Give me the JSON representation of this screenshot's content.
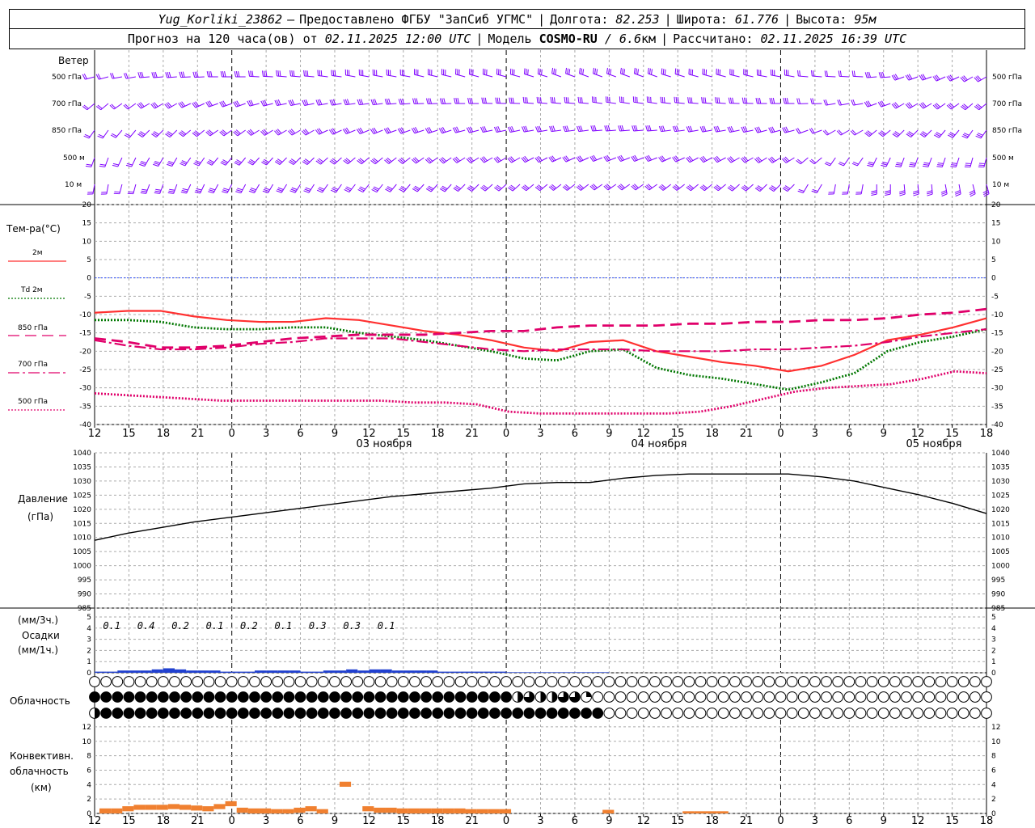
{
  "header": {
    "station": "Yug_Korliki_23862",
    "dash": "–",
    "provider": "Предоставлено ФГБУ \"ЗапСиб УГМС\"",
    "lon_label": "Долгота:",
    "lon_value": "82.253",
    "lat_label": "Широта:",
    "lat_value": "61.776",
    "alt_label": "Высота:",
    "alt_value": "95м",
    "forecast_prefix": "Прогноз на 120 часа(ов) от",
    "forecast_time": "02.11.2025 12:00 UTC",
    "model_label": "Модель",
    "model_name": "COSMO-RU",
    "model_res": "/ 6.6",
    "model_res_unit": "км",
    "calc_label": "Рассчитано:",
    "calc_time": "02.11.2025 16:39 UTC"
  },
  "panels": {
    "wind": {
      "title": "Ветер",
      "levels": [
        "500 гПа",
        "700 гПа",
        "850 гПа",
        "500 м",
        "10 м"
      ],
      "color": "#7f00ff"
    },
    "temperature": {
      "title": "Тем-ра(°С)",
      "legend": [
        {
          "label": "2м",
          "color": "#ff3030",
          "dash": "solid"
        },
        {
          "label": "Td 2м",
          "color": "#007700",
          "dash": "dots"
        },
        {
          "label": "850 гПа",
          "color": "#e0006a",
          "dash": "longdash"
        },
        {
          "label": "700 гПа",
          "color": "#e0006a",
          "dash": "dashdot"
        },
        {
          "label": "500 гПа",
          "color": "#e0006a",
          "dash": "dots"
        }
      ]
    },
    "pressure": {
      "title": "Давление",
      "unit": "(гПа)"
    },
    "precip": {
      "unit3": "(мм/3ч.)",
      "title": "Осадки",
      "unit1": "(мм/1ч.)"
    },
    "cloud": {
      "title": "Облачность"
    },
    "convective": {
      "line1": "Конвективн.",
      "line2": "облачность",
      "unit": "(км)"
    }
  },
  "x_axis": {
    "hour_labels": [
      "12",
      "15",
      "18",
      "21",
      "0",
      "3",
      "6",
      "9",
      "12",
      "15",
      "18",
      "21",
      "0",
      "3",
      "6",
      "9",
      "12",
      "15",
      "18",
      "21",
      "0",
      "3",
      "6",
      "9",
      "12",
      "15",
      "18"
    ],
    "dates": [
      "03 ноября",
      "04 ноября",
      "05 ноября"
    ]
  },
  "chart_data": [
    {
      "type": "line",
      "title": "Тем-ра(°С)",
      "ylim": [
        -40,
        20
      ],
      "y_ticks": [
        "20",
        "15",
        "10",
        "5",
        "0",
        "-5",
        "-10",
        "-15",
        "-20",
        "-25",
        "-30",
        "-35",
        "-40"
      ],
      "x_hours_from_start": [
        0,
        3,
        6,
        9,
        12,
        15,
        18,
        21,
        24,
        27,
        30,
        33,
        36,
        39,
        42,
        45,
        48,
        51,
        54,
        57,
        60,
        63,
        66,
        69,
        72,
        75,
        78
      ],
      "series": [
        {
          "name": "2м",
          "values": [
            -9.5,
            -9,
            -9,
            -10.5,
            -11.5,
            -12,
            -12,
            -11,
            -11.5,
            -13,
            -14.5,
            -15.5,
            -17,
            -19,
            -20,
            -17.5,
            -17,
            -20,
            -21.5,
            -23,
            -24,
            -25.5,
            -24,
            -21,
            -17,
            -15.5,
            -13.5,
            -11
          ]
        },
        {
          "name": "Td 2м",
          "values": [
            -11.5,
            -11.5,
            -12,
            -13.5,
            -14,
            -14,
            -13.5,
            -13.5,
            -15,
            -16,
            -17,
            -18.5,
            -20,
            -22,
            -22.5,
            -20,
            -19.5,
            -24.5,
            -26.5,
            -27.5,
            -29,
            -30.5,
            -28.5,
            -26,
            -20,
            -17.5,
            -16,
            -14
          ]
        },
        {
          "name": "850 гПа",
          "values": [
            -16.5,
            -17.5,
            -19,
            -19,
            -18.5,
            -17.5,
            -16.5,
            -16,
            -15.5,
            -15.5,
            -15.5,
            -15,
            -14.5,
            -14.5,
            -13.5,
            -13,
            -13,
            -13,
            -12.5,
            -12.5,
            -12,
            -12,
            -11.5,
            -11.5,
            -11,
            -10,
            -9.5,
            -8.5
          ]
        },
        {
          "name": "700 гПа",
          "values": [
            -17,
            -18.5,
            -19.5,
            -19.5,
            -19,
            -18,
            -17.5,
            -16.5,
            -16.5,
            -16.5,
            -17.5,
            -18.5,
            -19.5,
            -20,
            -19.5,
            -19.5,
            -19.5,
            -20,
            -20,
            -20,
            -19.5,
            -19.5,
            -19,
            -18.5,
            -17.5,
            -16,
            -15,
            -14
          ]
        },
        {
          "name": "500 гПа",
          "values": [
            -31.5,
            -32,
            -32.5,
            -33,
            -33.5,
            -33.5,
            -33.5,
            -33.5,
            -33.5,
            -33.5,
            -34,
            -34,
            -34.5,
            -36.5,
            -37,
            -37,
            -37,
            -37,
            -37,
            -36.5,
            -35,
            -33,
            -31,
            -30,
            -29.5,
            -29,
            -27.5,
            -25.5,
            -26
          ]
        }
      ]
    },
    {
      "type": "line",
      "title": "Давление",
      "ylabel": "(гПа)",
      "ylim": [
        985,
        1040
      ],
      "y_ticks": [
        "1040",
        "1035",
        "1030",
        "1025",
        "1020",
        "1015",
        "1010",
        "1005",
        "1000",
        "995",
        "990",
        "985"
      ],
      "x_hours_from_start": [
        0,
        3,
        6,
        9,
        12,
        15,
        18,
        21,
        24,
        27,
        30,
        33,
        36,
        39,
        42,
        45,
        48,
        51,
        54,
        57,
        60,
        63,
        66,
        69,
        72,
        75,
        78
      ],
      "series": [
        {
          "name": "Давление",
          "values": [
            1009,
            1011.5,
            1013.5,
            1015.5,
            1017,
            1018.5,
            1020,
            1021.5,
            1023,
            1024.5,
            1025.5,
            1026.5,
            1027.5,
            1029,
            1029.5,
            1029.5,
            1031,
            1032,
            1032.5,
            1032.5,
            1032.5,
            1032.5,
            1031.5,
            1030,
            1027.5,
            1025,
            1022,
            1018.5
          ]
        }
      ]
    },
    {
      "type": "bar",
      "title": "Осадки",
      "ylabel": "(мм/3ч.) / (мм/1ч.)",
      "ylim": [
        0,
        5
      ],
      "y_ticks": [
        "5",
        "4",
        "3",
        "2",
        "1",
        "0"
      ],
      "labels_3h": [
        "0.1",
        "0.4",
        "0.2",
        "0.1",
        "0.2",
        "0.1",
        "0.3",
        "0.3",
        "0.1"
      ],
      "hourly_values": [
        0.1,
        0.1,
        0.2,
        0.2,
        0.2,
        0.3,
        0.4,
        0.3,
        0.2,
        0.2,
        0.2,
        0.1,
        0.1,
        0.1,
        0.2,
        0.2,
        0.2,
        0.2,
        0.1,
        0.1,
        0.2,
        0.2,
        0.3,
        0.2,
        0.3,
        0.3,
        0.2,
        0.2,
        0.2,
        0.2,
        0.1,
        0.1,
        0.1,
        0.1,
        0.1,
        0.1,
        0.05,
        0.05,
        0.05,
        0.05,
        0.05,
        0.05,
        0.05,
        0.05,
        0.05,
        0
      ]
    },
    {
      "type": "bar",
      "title": "Конвективн. облачность",
      "ylabel": "(км)",
      "ylim": [
        0,
        13
      ],
      "y_ticks": [
        "12",
        "10",
        "8",
        "6",
        "4",
        "2",
        "0"
      ],
      "hourly_values": [
        0.7,
        0.7,
        1.0,
        1.2,
        1.2,
        1.2,
        1.3,
        1.2,
        1.1,
        1.0,
        1.3,
        1.7,
        0.8,
        0.7,
        0.7,
        0.6,
        0.6,
        0.8,
        1.0,
        0.6,
        0,
        4.4,
        0,
        1.0,
        0.8,
        0.8,
        0.7,
        0.7,
        0.7,
        0.7,
        0.7,
        0.7,
        0.6,
        0.6,
        0.6,
        0.6,
        0,
        0,
        0,
        0,
        0,
        0,
        0,
        0,
        0.5,
        0,
        0,
        0,
        0,
        0,
        0,
        0.3,
        0.3,
        0.3,
        0.3
      ]
    }
  ],
  "clouds": {
    "rows": [
      {
        "name": "upper",
        "values": [
          0,
          0,
          0,
          0,
          0,
          0,
          0,
          0,
          0,
          0,
          0,
          0,
          0,
          0,
          0,
          0,
          0,
          0,
          0,
          0,
          0,
          0,
          0,
          0,
          0,
          0,
          0,
          0,
          0,
          0,
          0,
          0,
          0,
          0,
          0,
          0,
          0,
          0,
          0,
          0,
          0,
          0,
          0,
          0,
          0,
          0,
          0,
          0,
          0,
          0,
          0,
          0,
          0,
          0,
          0,
          0,
          0,
          0,
          0,
          0,
          0,
          0,
          0,
          0,
          0,
          0,
          0,
          0,
          0,
          0,
          0,
          0,
          0,
          0,
          0,
          0,
          0,
          0,
          0,
          0,
          0,
          0,
          0,
          0,
          0,
          0,
          0,
          0,
          0,
          0,
          0,
          0,
          0,
          0,
          0,
          0,
          0,
          0,
          0,
          0,
          0,
          0,
          0,
          0,
          0,
          0,
          0,
          0,
          0,
          0,
          0,
          0,
          0,
          0,
          0,
          0,
          0,
          0,
          0,
          0,
          0,
          0,
          0,
          0,
          0,
          0,
          0,
          0,
          0,
          0,
          0,
          0,
          0,
          0,
          0,
          0,
          0,
          0,
          0,
          0,
          0,
          0,
          0,
          0,
          0,
          0,
          0,
          0,
          0,
          0,
          0,
          0,
          0,
          0,
          0,
          0,
          0,
          0,
          0,
          0,
          0,
          0,
          0,
          0,
          0,
          0,
          0,
          0,
          0,
          0,
          0,
          0,
          0,
          0,
          0,
          0,
          0,
          0,
          0,
          0,
          0,
          0,
          0,
          0,
          0,
          0,
          0,
          0,
          0,
          0,
          0,
          0,
          0,
          0,
          0,
          0,
          0,
          0,
          0,
          0,
          0,
          0,
          0
        ]
      },
      {
        "name": "middle"
      },
      {
        "name": "lower"
      }
    ],
    "upper": [
      0,
      0,
      0,
      0,
      0,
      0,
      0,
      0,
      0,
      0,
      0,
      0,
      0,
      0,
      0,
      0,
      0,
      0,
      0,
      0,
      0,
      0,
      0,
      0,
      0,
      0,
      0,
      0,
      0,
      0,
      0,
      0,
      0,
      0,
      0,
      0,
      0,
      0,
      0,
      0,
      0,
      0,
      0,
      0,
      0,
      0,
      0,
      0,
      0,
      0,
      0,
      0,
      0,
      0,
      0,
      0,
      0,
      0,
      0,
      0,
      0,
      0,
      0,
      0,
      0,
      0,
      0,
      0,
      0,
      0,
      0,
      0,
      0,
      0,
      0,
      0,
      0,
      0,
      0
    ],
    "middle": [
      1,
      1,
      1,
      1,
      1,
      1,
      1,
      1,
      1,
      1,
      1,
      1,
      1,
      1,
      1,
      1,
      1,
      1,
      1,
      1,
      1,
      1,
      1,
      1,
      1,
      1,
      1,
      1,
      1,
      1,
      1,
      1,
      1,
      1,
      1,
      1,
      1,
      0.5,
      0.75,
      0.5,
      0.5,
      0.75,
      0.75,
      0.25,
      0,
      0,
      0,
      0,
      0,
      0,
      0,
      0,
      0,
      0,
      0,
      0,
      0,
      0,
      0,
      0,
      0,
      0,
      0,
      0,
      0,
      0,
      0,
      0,
      0,
      0,
      0,
      0,
      0,
      0,
      0,
      0,
      0,
      0,
      0
    ],
    "lower": [
      0.5,
      1,
      1,
      1,
      1,
      1,
      1,
      1,
      1,
      1,
      1,
      1,
      1,
      1,
      1,
      1,
      1,
      1,
      1,
      1,
      1,
      1,
      1,
      1,
      1,
      1,
      1,
      1,
      1,
      1,
      1,
      1,
      1,
      1,
      1,
      1,
      1,
      1,
      1,
      1,
      1,
      1,
      1,
      1,
      1,
      0,
      0,
      0,
      0,
      0,
      0,
      0,
      0,
      0,
      0,
      0,
      0,
      0,
      0,
      0,
      0,
      0,
      0,
      0,
      0,
      0,
      0,
      0,
      0,
      0,
      0,
      0,
      0,
      0,
      0,
      0,
      0,
      0,
      0
    ]
  }
}
